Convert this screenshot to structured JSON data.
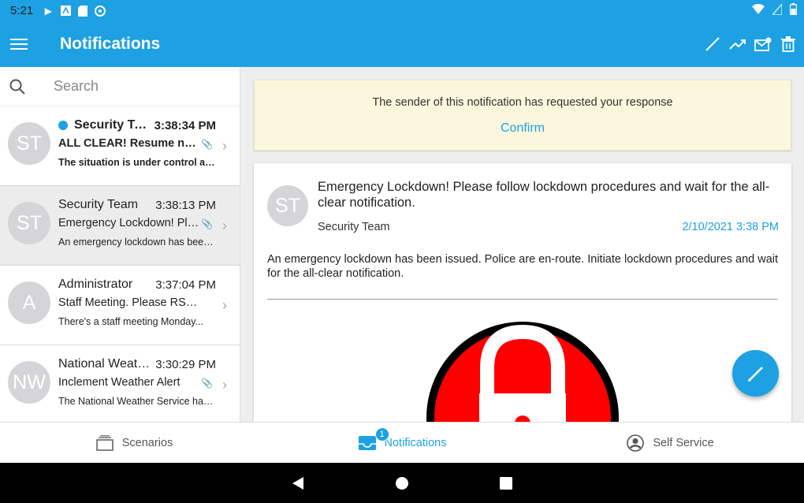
{
  "status_bar": {
    "time": "5:21"
  },
  "app_bar": {
    "title": "Notifications"
  },
  "search": {
    "placeholder": "Search"
  },
  "notifications": [
    {
      "initials": "ST",
      "sender": "Security Team",
      "time": "3:38:34 PM",
      "subject": "ALL CLEAR! Resume normal operations",
      "preview": "The situation is under control and normal operations may resume.",
      "unread": true
    },
    {
      "initials": "ST",
      "sender": "Security Team",
      "time": "3:38:13 PM",
      "subject": "Emergency Lockdown! Please follow lockdown procedures",
      "preview": "An emergency lockdown has been issued.",
      "unread": false
    },
    {
      "initials": "A",
      "sender": "Administrator",
      "time": "3:37:04 PM",
      "subject": "Staff Meeting. Please RSVP.",
      "preview": "There's a staff meeting Monday...",
      "unread": false
    },
    {
      "initials": "NW",
      "sender": "National Weather Service",
      "time": "3:30:29 PM",
      "subject": "Inclement Weather Alert",
      "preview": "The National Weather Service has issued an alert.",
      "unread": false
    }
  ],
  "response_banner": {
    "message": "The sender of this notification has requested your response",
    "confirm_label": "Confirm"
  },
  "detail": {
    "initials": "ST",
    "subject": "Emergency Lockdown! Please follow lockdown procedures and wait for the all-clear notification.",
    "sender": "Security Team",
    "date": "2/10/2021 3:38 PM",
    "body": "An emergency lockdown has been issued. Police are en-route. Initiate lockdown procedures and wait for the all-clear notification."
  },
  "bottom_nav": {
    "scenarios": "Scenarios",
    "notifications": "Notifications",
    "notifications_badge": "1",
    "self_service": "Self Service"
  },
  "colors": {
    "accent": "#1da1e2",
    "banner": "#fbf7dc",
    "lock_red": "#ff0000"
  }
}
